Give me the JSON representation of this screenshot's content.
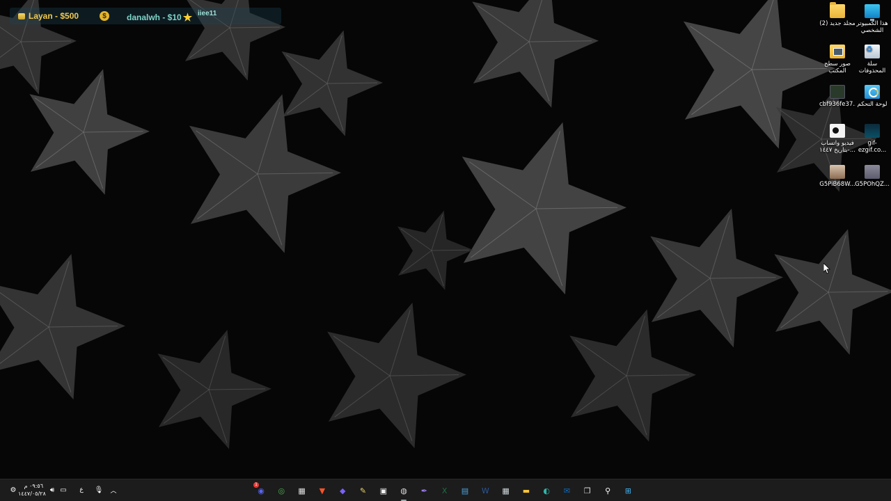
{
  "overlay": {
    "left_text": "Layan - $500",
    "dollar_glyph": "$",
    "mid_text": "danalwh - $10",
    "right_text": "iiee11"
  },
  "desktop_icons": [
    {
      "label": "هذا الكمبيوتر الشخصي",
      "icon": "monitor-icon"
    },
    {
      "label": "مجلد جديد (2)",
      "icon": "folder-icon"
    },
    {
      "label": "سلة المحذوفات",
      "icon": "recycle-bin-icon"
    },
    {
      "label": "صور سطح المكتب",
      "icon": "photos-folder-icon"
    },
    {
      "label": "لوحة التحكم",
      "icon": "control-panel-icon"
    },
    {
      "label": "cbf936fe37...",
      "icon": "file-icon"
    },
    {
      "label": "gif-ezgif.co...",
      "icon": "gif-icon"
    },
    {
      "label": "فيديو واتساب بتاريخ ١٤٤٧-...",
      "icon": "video-icon"
    },
    {
      "label": "G5POhQZ...",
      "icon": "image-icon"
    },
    {
      "label": "G5PiB68W...",
      "icon": "image-icon"
    }
  ],
  "taskbar": {
    "clock": {
      "time": "٠٩:٥٦ م",
      "date": "١٤٤٧/٠٥/٢٨"
    },
    "language": "ع",
    "apps": [
      {
        "name": "discord-icon",
        "glyph": "◉",
        "color": "#5865f2",
        "badge": "1"
      },
      {
        "name": "chrome-icon",
        "glyph": "◎",
        "color": "#4caf50"
      },
      {
        "name": "calendar-app-icon",
        "glyph": "▦",
        "color": "#e0e0e0"
      },
      {
        "name": "brave-icon",
        "glyph": "▼",
        "color": "#fb542b"
      },
      {
        "name": "proton-vpn-icon",
        "glyph": "◆",
        "color": "#7b61ff"
      },
      {
        "name": "notes-app-icon",
        "glyph": "✎",
        "color": "#e8d36a"
      },
      {
        "name": "microsoft-store-icon",
        "glyph": "▣",
        "color": "#f2f2f2"
      },
      {
        "name": "obs-studio-icon",
        "glyph": "◍",
        "color": "#dddddd"
      },
      {
        "name": "feather-app-icon",
        "glyph": "✒",
        "color": "#9b7bff"
      },
      {
        "name": "excel-icon",
        "glyph": "X",
        "color": "#1d6f42"
      },
      {
        "name": "notepad-icon",
        "glyph": "▤",
        "color": "#4aa3df"
      },
      {
        "name": "word-icon",
        "glyph": "W",
        "color": "#2b579a"
      },
      {
        "name": "calculator-icon",
        "glyph": "▦",
        "color": "#cfd8dc"
      },
      {
        "name": "file-explorer-icon",
        "glyph": "▬",
        "color": "#f6c33b"
      },
      {
        "name": "edge-icon",
        "glyph": "◐",
        "color": "#2fb5a8"
      },
      {
        "name": "outlook-icon",
        "glyph": "✉",
        "color": "#0f6cbd"
      },
      {
        "name": "task-view-icon",
        "glyph": "❐",
        "color": "#dddddd"
      },
      {
        "name": "search-icon",
        "glyph": "⚲",
        "color": "#ffffff"
      },
      {
        "name": "start-icon",
        "glyph": "⊞",
        "color": "#3fb4f5"
      }
    ]
  }
}
